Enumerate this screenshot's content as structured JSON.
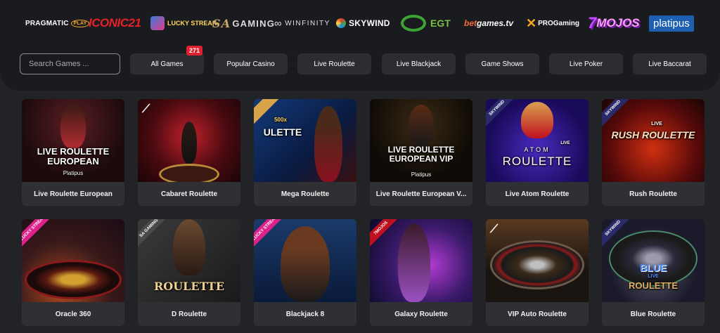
{
  "providers": {
    "pragmatic": "PRAGMATIC",
    "pragmatic_play": "PLAY",
    "iconic": "ICONIC21",
    "lucky": "LUCKY STREAK",
    "sagaming_sa": "SA",
    "sagaming": "GAMING",
    "winfinity": "WINFINITY",
    "skywind": "SKYWIND",
    "egt": "EGT",
    "betgames_bet": "bet",
    "betgames": "games.tv",
    "progaming": "PROGaming",
    "mojos_seven": "7",
    "mojos": "MOJOS",
    "platipus": "platipus"
  },
  "search": {
    "placeholder": "Search Games ..."
  },
  "categories": {
    "all_games": "All Games",
    "all_games_count": "271",
    "popular": "Popular Casino",
    "roulette": "Live Roulette",
    "blackjack": "Live Blackjack",
    "gameshows": "Game Shows",
    "poker": "Live Poker",
    "baccarat": "Live Baccarat"
  },
  "games": [
    {
      "name": "Live Roulette European",
      "thumb_title": "LIVE ROULETTE EUROPEAN",
      "thumb_sub": "Platipus"
    },
    {
      "name": "Cabaret Roulette"
    },
    {
      "name": "Mega Roulette",
      "thumb_title": "ULETTE",
      "thumb_sub": "500x"
    },
    {
      "name": "Live Roulette European V...",
      "thumb_title": "LIVE ROULETTE EUROPEAN VIP",
      "thumb_sub": "Platipus"
    },
    {
      "name": "Live Atom Roulette",
      "thumb_title": "ROULETTE",
      "thumb_sub": "ATOM",
      "thumb_live": "LIVE",
      "tag": "SKYWIND"
    },
    {
      "name": "Rush Roulette",
      "thumb_title": "RUSH ROULETTE",
      "thumb_live": "LIVE",
      "tag": "SKYWIND"
    },
    {
      "name": "Oracle 360",
      "tag": "LUCKY STREAK"
    },
    {
      "name": "D Roulette",
      "thumb_title": "ROULETTE",
      "tag": "SA GAMING"
    },
    {
      "name": "Blackjack 8",
      "tag": "LUCKY STREAK"
    },
    {
      "name": "Galaxy Roulette",
      "tag": "7MOJOS"
    },
    {
      "name": "VIP Auto Roulette"
    },
    {
      "name": "Blue Roulette",
      "thumb_title": "BLUE ROULETTE",
      "thumb_live": "LIVE",
      "tag": "SKYWIND"
    }
  ],
  "colors": {
    "page_bg": "#222326",
    "panel_bg": "#1a1b1e",
    "badge": "#e02030",
    "button_bg": "#2c2d31"
  }
}
